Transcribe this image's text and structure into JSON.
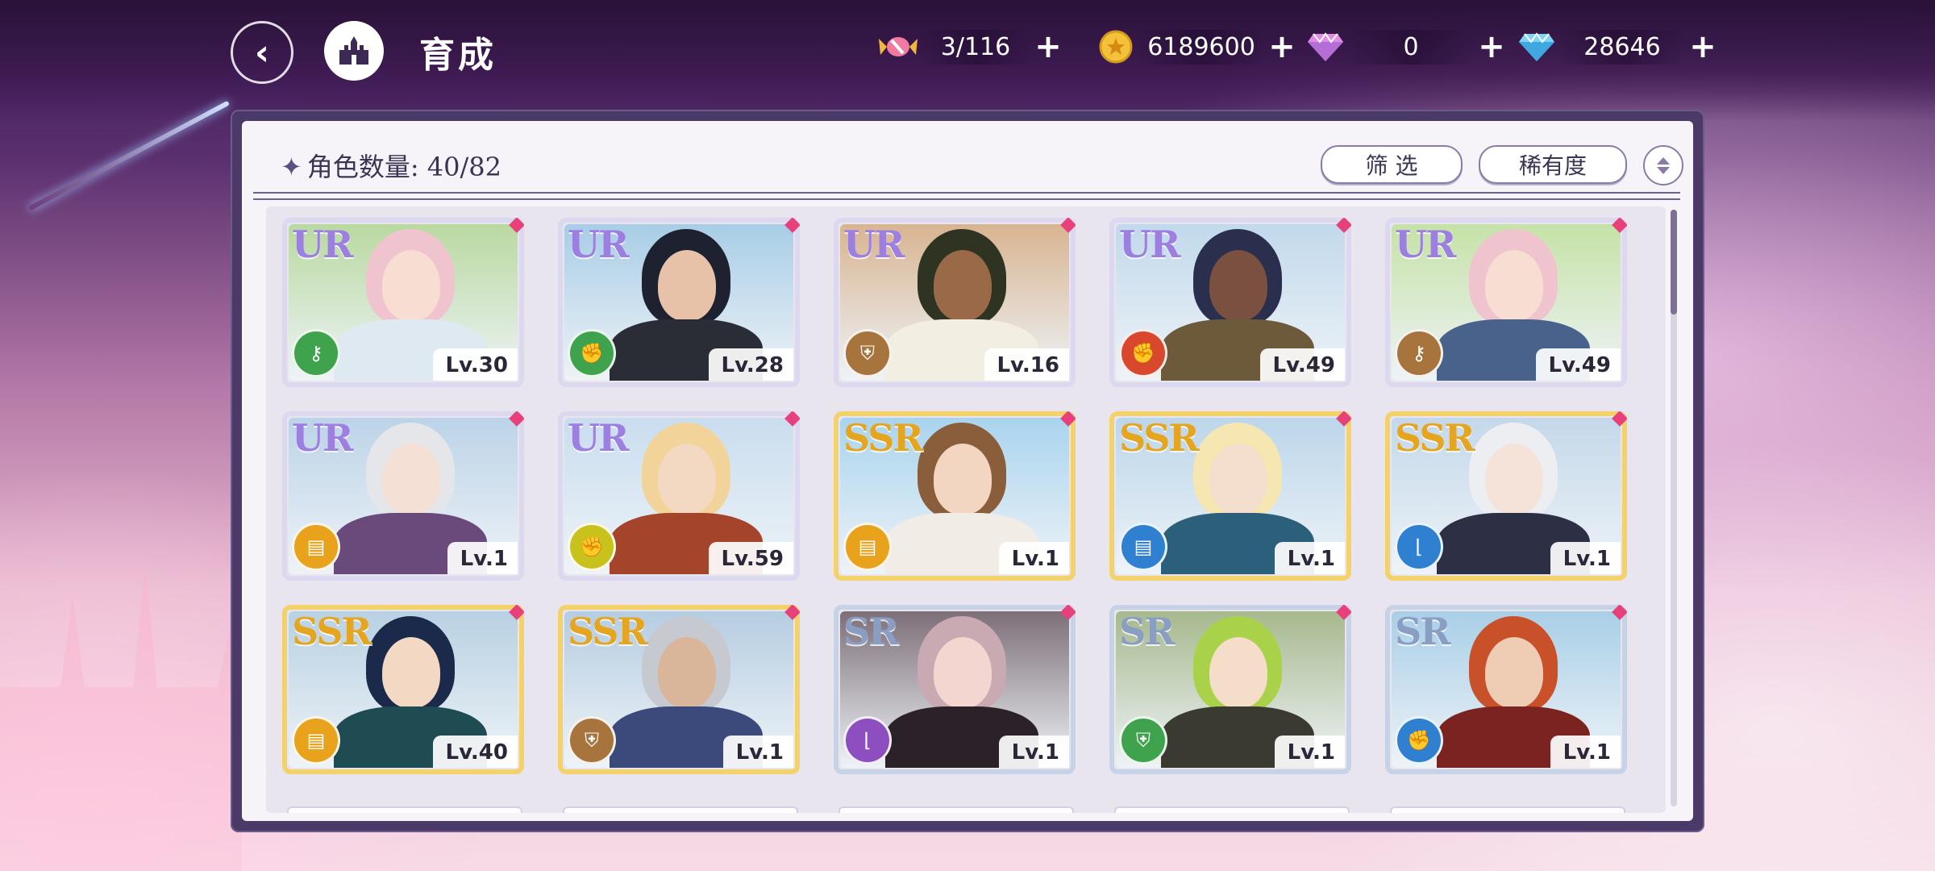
{
  "header": {
    "page_title": "育成",
    "resources": [
      {
        "icon": "candy-icon",
        "value": "3/116"
      },
      {
        "icon": "gold-coin-icon",
        "value": "6189600"
      },
      {
        "icon": "pink-diamond-icon",
        "value": "0"
      },
      {
        "icon": "blue-diamond-icon",
        "value": "28646"
      }
    ],
    "plus_label": "+"
  },
  "panel": {
    "count_label": "角色数量: 40/82",
    "filter_label": "筛 选",
    "rarity_label": "稀有度"
  },
  "cards": [
    {
      "rarity": "UR",
      "level": "Lv.30",
      "element_color": "#3fa34d",
      "element_icon": "key-icon",
      "hair": "#f0c4cf",
      "skin": "#f7ddd2",
      "cloth": "#dfe9f2",
      "bg": "#b9d9a0"
    },
    {
      "rarity": "UR",
      "level": "Lv.28",
      "element_color": "#3fa34d",
      "element_icon": "fist-icon",
      "hair": "#1e2230",
      "skin": "#e8c2a8",
      "cloth": "#2b2d36",
      "bg": "#a8cde6"
    },
    {
      "rarity": "UR",
      "level": "Lv.16",
      "element_color": "#a8743d",
      "element_icon": "shield-icon",
      "hair": "#2f3322",
      "skin": "#9a6a48",
      "cloth": "#f3eee2",
      "bg": "#d8b491"
    },
    {
      "rarity": "UR",
      "level": "Lv.49",
      "element_color": "#d9482d",
      "element_icon": "fist-icon",
      "hair": "#2b2f4e",
      "skin": "#7a5040",
      "cloth": "#6d5a3a",
      "bg": "#c2d9ec"
    },
    {
      "rarity": "UR",
      "level": "Lv.49",
      "element_color": "#a8743d",
      "element_icon": "key-icon",
      "hair": "#f0c4cf",
      "skin": "#f7ddd2",
      "cloth": "#49628c",
      "bg": "#c6e2a7"
    },
    {
      "rarity": "UR",
      "level": "Lv.1",
      "element_color": "#e8a21c",
      "element_icon": "book-icon",
      "hair": "#e4e6ea",
      "skin": "#f5e0d6",
      "cloth": "#6a4a7a",
      "bg": "#bcd3e8"
    },
    {
      "rarity": "UR",
      "level": "Lv.59",
      "element_color": "#c9c21c",
      "element_icon": "fist-icon",
      "hair": "#f2d49a",
      "skin": "#f3d8c2",
      "cloth": "#a4442a",
      "bg": "#c9ddef"
    },
    {
      "rarity": "SSR",
      "level": "Lv.1",
      "element_color": "#e8a21c",
      "element_icon": "book-icon",
      "hair": "#8a5e3a",
      "skin": "#f3d6c2",
      "cloth": "#f1ece6",
      "bg": "#a9d4ee"
    },
    {
      "rarity": "SSR",
      "level": "Lv.1",
      "element_color": "#2f80d0",
      "element_icon": "book-icon",
      "hair": "#f5e6b2",
      "skin": "#f4dfce",
      "cloth": "#2b5f7a",
      "bg": "#bcd6ea"
    },
    {
      "rarity": "SSR",
      "level": "Lv.1",
      "element_color": "#2f80d0",
      "element_icon": "boot-icon",
      "hair": "#eceef2",
      "skin": "#f5e2d8",
      "cloth": "#2d2f45",
      "bg": "#c4d8ea"
    },
    {
      "rarity": "SSR",
      "level": "Lv.40",
      "element_color": "#e8a21c",
      "element_icon": "book-icon",
      "hair": "#1b2a4a",
      "skin": "#f3d9c4",
      "cloth": "#1f4b52",
      "bg": "#b8d1e3"
    },
    {
      "rarity": "SSR",
      "level": "Lv.1",
      "element_color": "#a8743d",
      "element_icon": "shield-icon",
      "hair": "#c6c9d0",
      "skin": "#d9b59a",
      "cloth": "#3b4a7a",
      "bg": "#b5cde2"
    },
    {
      "rarity": "SR",
      "level": "Lv.1",
      "element_color": "#8d4fbf",
      "element_icon": "boot-icon",
      "hair": "#c9a9b2",
      "skin": "#f2d6cf",
      "cloth": "#2a2228",
      "bg": "#7d6f78"
    },
    {
      "rarity": "SR",
      "level": "Lv.1",
      "element_color": "#3fa34d",
      "element_icon": "shield-icon",
      "hair": "#a9d24a",
      "skin": "#f4ddc9",
      "cloth": "#3b3a30",
      "bg": "#a7b98d"
    },
    {
      "rarity": "SR",
      "level": "Lv.1",
      "element_color": "#2f80d0",
      "element_icon": "fist-icon",
      "hair": "#c9512a",
      "skin": "#efcdb5",
      "cloth": "#7a2320",
      "bg": "#a9cfe8"
    }
  ],
  "rarity_colors": {
    "UR": {
      "text": "#9c7fe0",
      "frame": "#dcd8f0"
    },
    "SSR": {
      "text": "#e6a51f",
      "frame": "#f3d26a"
    },
    "SR": {
      "text": "#8a9ec4",
      "frame": "#c6d3e6"
    }
  }
}
